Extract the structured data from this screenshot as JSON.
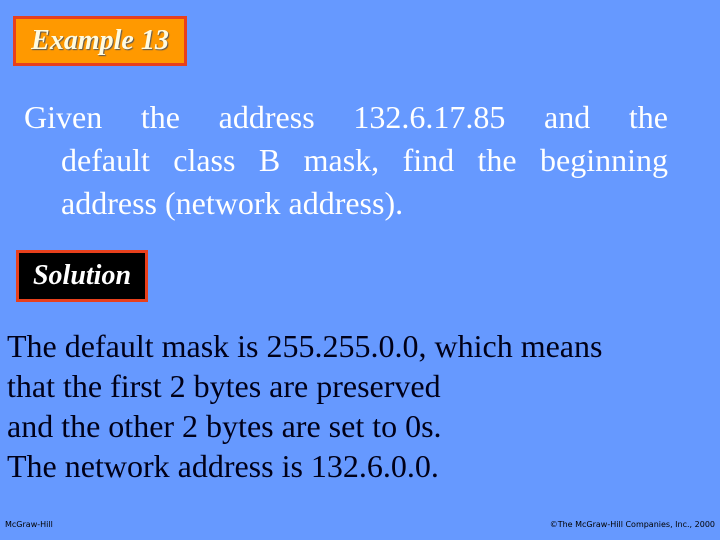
{
  "slide": {
    "example_tag": "Example 13",
    "problem_lines": [
      "Given the address 132.6.17.85 and the",
      "default class B mask, find the beginning",
      "address (network address)."
    ],
    "solution_tag": "Solution",
    "answer_lines": [
      "The default mask is 255.255.0.0, which means",
      "that the first 2 bytes are preserved",
      "and the other 2 bytes are set to 0s.",
      "The network address is 132.6.0.0."
    ]
  },
  "footer": {
    "publisher": "McGraw-Hill",
    "copyright": "©The McGraw-Hill Companies, Inc., 2000"
  },
  "colors": {
    "background": "#6699ff",
    "example_tag_fill": "#ff9900",
    "tag_border": "#e8401c",
    "solution_tag_fill": "#000000"
  }
}
